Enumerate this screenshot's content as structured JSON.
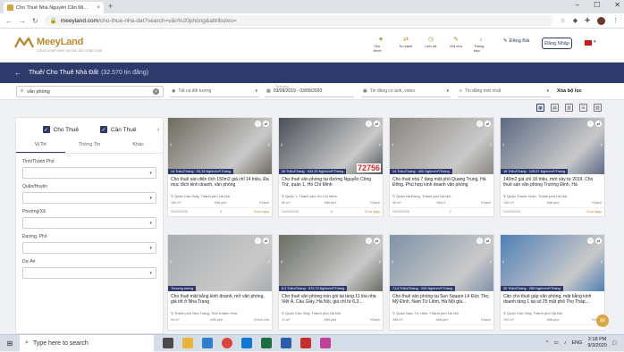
{
  "browser": {
    "tab_title": "Cho Thuê Nhà Nguyên Căn Mi...",
    "url_host": "meeyland.com",
    "url_path": "/cho-thue-nha-dat?search=văn%20phòng&attributes="
  },
  "header": {
    "brand": "MeeyLand",
    "brand_sub": "CÔNG NGHỆ ĐỊNH HƯỚNG BẤT ĐỘNG SẢN",
    "nav": [
      {
        "label": "Yêu thích",
        "icon": "heart-icon"
      },
      {
        "label": "So sánh",
        "icon": "compare-icon"
      },
      {
        "label": "Lịch sử",
        "icon": "history-icon"
      },
      {
        "label": "Ghi chú",
        "icon": "note-icon"
      },
      {
        "label": "Thông báo",
        "icon": "bell-icon"
      }
    ],
    "post_label": "Đăng Bài",
    "login_label": "Đăng Nhập",
    "accent": "#b98a2e",
    "primary": "#2d3a6b"
  },
  "banner": {
    "title": "Thuê/ Cho Thuê Nhà Đất",
    "count": "(32.570 tin đăng)"
  },
  "filters": {
    "search_value": "văn phòng",
    "audience": "Tất cả đối tượng",
    "time_label": "Thời gian",
    "time_value": "03/09/2019 - 03/09/2020",
    "media": "Tin đăng có ảnh, video",
    "sort": "Tin đăng mới nhất",
    "clear_label": "Xóa bộ lọc"
  },
  "left": {
    "checks": [
      "Cho Thuê",
      "Cần Thuê"
    ],
    "tabs": [
      "Vị Trí",
      "Thông Tin",
      "Khác"
    ],
    "fields": [
      "Tỉnh/Thành Phố",
      "Quận/Huyện",
      "Phường/Xã",
      "Đường, Phố",
      "Dự Án"
    ]
  },
  "cards": [
    {
      "badge": "14 Triệu/Tháng · 93,33 Nghìn/m²/Tháng",
      "title": "Cho thuê sàn diện tích 150m2 giá chỉ 14 triệu. Đa mục đích kinh doanh, văn phòng",
      "loc": "Quận Cầu Giấy, Thành phố Hà Nội",
      "area": "150 m²",
      "dir": "Mặt phố",
      "type": "Khách",
      "date": "03/09/2020",
      "views": "3",
      "chat": "Chat ngay",
      "img": "#6e6a5e"
    },
    {
      "badge": "26 Triệu/Tháng · 433,33 Nghìn/m²/Tháng",
      "title": "Cho thuê văn phòng tại đường Nguyễn Công Trứ, quận 1, Hồ Chí Minh",
      "loc": "Quận 1, Thành phố Hồ Chí Minh",
      "area": "60 m²",
      "dir": "Mặt phố",
      "type": "Khách",
      "date": "03/09/2020",
      "views": "6",
      "chat": "Chat ngay",
      "img": "#4a5058"
    },
    {
      "badge": "14 Triệu/Tháng · 400 Nghìn/m²/Tháng",
      "title": "Cho thuê nhà 7 tầng mặt phố Quang Trung, Hà Đông. Phù hợp kinh doanh văn phòng",
      "loc": "Quận Hà Đông, Thành phố Hà Nội",
      "area": "35 m²",
      "dir": "Nhà 4",
      "type": "Khách",
      "date": "03/09/2020",
      "views": "2",
      "chat": "",
      "img": "#8a8680"
    },
    {
      "badge": "18 Triệu/Tháng · 128,57 Nghìn/m²/Tháng",
      "title": "140m2 giá chỉ 18 triệu, mới xây từ 2019. Cho thuê sàn văn phòng Trường Định, Hà",
      "loc": "Quận Thanh Xuân, Thành phố Hà Nội",
      "area": "140 m²",
      "dir": "Mặt phố",
      "type": "Khách",
      "date": "03/09/2020",
      "views": "",
      "chat": "Chat ngay",
      "img": "#5b6a82"
    },
    {
      "badge": "Thương lượng",
      "title": "Cho thuê mặt bằng kinh doanh, mở văn phòng, giá tốt ở Nha Trang",
      "loc": "Thành phố Nha Trang, Tỉnh Khánh Hòa",
      "area": "90 m²",
      "dir": "Mặt phố",
      "type": "Chính chủ",
      "date": "",
      "views": "",
      "chat": "",
      "img": "#a8acaf"
    },
    {
      "badge": "6,3 Triệu/Tháng · 572,73 Nghìn/m²/Tháng",
      "title": "Cho thuê văn phòng trọn gói tại tầng 11 tòa nhà Việt Á, Cầu Giấy, Hà Nội, giá chỉ từ 6,3...",
      "loc": "Quận Cầu Giấy, Thành phố Hà Nội",
      "area": "11 m²",
      "dir": "Mặt phố",
      "type": "Khách",
      "date": "",
      "views": "",
      "chat": "",
      "img": "#6a6e64"
    },
    {
      "badge": "71,6 Triệu/Tháng · 200 Nghìn/m²/Tháng",
      "title": "Cho thuê văn phòng tại Sun Square Lê Đức Thọ, Mỹ Đình, Nam Từ Liêm, Hà Nội giá...",
      "loc": "Quận Nam Từ Liêm, Thành phố Hà Nội",
      "area": "358 m²",
      "dir": "Mặt phố",
      "type": "Khách",
      "date": "",
      "views": "",
      "chat": "",
      "img": "#7f93a8"
    },
    {
      "badge": "25 Triệu/Tháng · 250 Nghìn/m²/Tháng",
      "title": "Cần cho thuê gấp văn phòng, mặt bằng kinh doanh tầng 1 tại số 25 mặt phố Thọ Tháp,...",
      "loc": "Quận Cầu Giấy, Thành phố Hà Nội",
      "area": "100 m²",
      "dir": "Mặt phố",
      "type": "Khách",
      "date": "",
      "views": "",
      "chat": "",
      "img": "#4f7fb5"
    }
  ],
  "card_watermark": "72756",
  "taskbar": {
    "search_placeholder": "Type here to search",
    "lang": "ENG",
    "time": "2:18 PM",
    "date": "9/3/2020"
  }
}
